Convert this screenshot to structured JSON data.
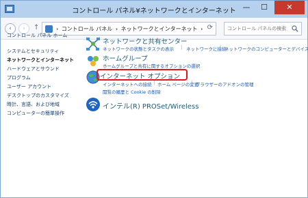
{
  "window": {
    "title": "コントロール パネル¥ネットワークとインターネット",
    "controls": {
      "minimize": "—",
      "maximize": "☐",
      "close": "✕"
    }
  },
  "nav": {
    "back": "‹",
    "forward": "›",
    "up": "↑"
  },
  "address": {
    "crumbs": [
      "›",
      "コントロール パネル",
      "›",
      "ネットワークとインターネット",
      "›"
    ],
    "refresh": "⟳"
  },
  "search": {
    "placeholder": "コントロール パネルの検索"
  },
  "sidebar": {
    "home": "コントロール パネル ホーム",
    "items": [
      "システムとセキュリティ",
      "ネットワークとインターネット",
      "ハードウェアとサウンド",
      "プログラム",
      "ユーザー アカウント",
      "デスクトップのカスタマイズ",
      "時計、言語、および地域",
      "コンピューターの簡単操作"
    ]
  },
  "categories": [
    {
      "title": "ネットワークと共有センター",
      "links": [
        "ネットワークの状態とタスクの表示",
        "ネットワークに接続",
        "ネットワークのコンピューターとデバイスの表示"
      ]
    },
    {
      "title": "ホームグループ",
      "links": [
        "ホームグループと共有に関するオプションの選択"
      ]
    },
    {
      "title": "インターネット オプション",
      "links": [
        "インターネットへの接続",
        "ホーム ページの変更",
        "ブラウザーのアドオンの管理",
        "閲覧の履歴と Cookie の削除"
      ]
    },
    {
      "title": "インテル(R) PROSet/Wireless",
      "links": []
    }
  ],
  "colors": {
    "accent": "#1a5bb5",
    "highlight": "#e3151a",
    "titlebar": "#b6d1ee"
  }
}
